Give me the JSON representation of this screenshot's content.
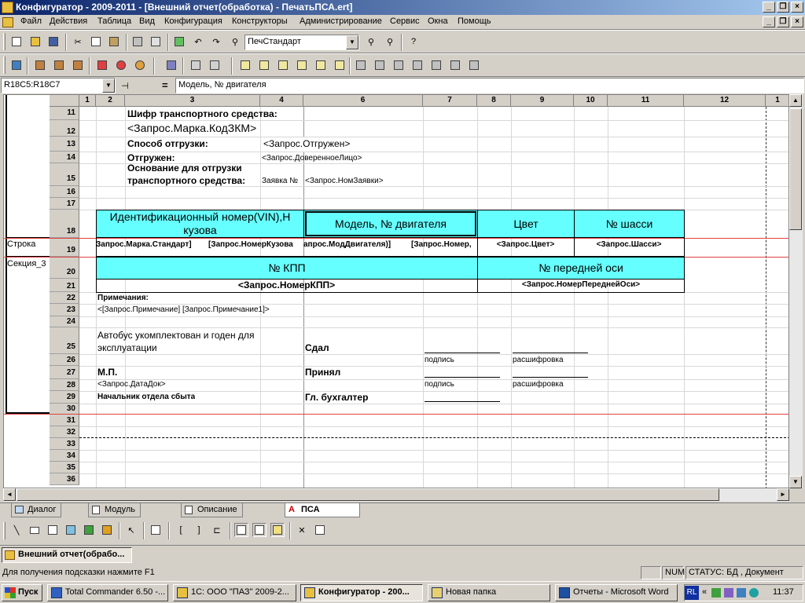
{
  "window": {
    "title": "Конфигуратор - 2009-2011 - [Внешний отчет(обработка) - ПечатьПСА.ert]"
  },
  "menu": [
    "Файл",
    "Действия",
    "Таблица",
    "Вид",
    "Конфигурация",
    "Конструкторы",
    "Администрирование",
    "Сервис",
    "Окна",
    "Помощь"
  ],
  "toolbar": {
    "font_combo": "ПечСтандарт"
  },
  "formula": {
    "cell_ref": "R18C5:R18C7",
    "eq": "=",
    "value": "Модель, № двигателя"
  },
  "columns": [
    "1",
    "2",
    "3",
    "4",
    "6",
    "7",
    "8",
    "9",
    "10",
    "11",
    "12",
    "1"
  ],
  "rows": [
    "11",
    "12",
    "13",
    "14",
    "15",
    "16",
    "17",
    "18",
    "19",
    "20",
    "21",
    "22",
    "23",
    "24",
    "25",
    "26",
    "27",
    "28",
    "29",
    "30",
    "31",
    "32",
    "33",
    "34",
    "35",
    "36"
  ],
  "groups": {
    "stroka": "Строка",
    "section": "Секция_3"
  },
  "cells": {
    "r11": "Шифр транспортного средства:",
    "r12": "<Запрос.Марка.КодЗКМ>",
    "r13a": "Способ отгрузки:",
    "r13b": "<Запрос.Отгружен>",
    "r14a": "Отгружен:",
    "r14b": "<Запрос.ДоверенноеЛицо>",
    "r15top": "Основание для отгрузки",
    "r15a": "транспортного средства:",
    "r15b": "Заявка №",
    "r15c": "<Запрос.НомЗаявки>",
    "h_vin1": "Идентификационный номер(VIN),Н",
    "h_vin2": "кузова",
    "h_model": "Модель, № двигателя",
    "h_color": "Цвет",
    "h_chassis": "№ шасси",
    "r19a": "Запрос.Марка.Стандарт]",
    "r19b": "[Запрос.НомерКузова",
    "r19c": "апрос.МодДвигателя)]",
    "r19d": "[Запрос.Номер,",
    "r19e": "<Запрос.Цвет>",
    "r19f": "<Запрос.Шасси>",
    "h_kpp": "№ КПП",
    "h_axle": "№ передней оси",
    "r21a": "<Запрос.НомерКПП>",
    "r21b": "<Запрос.НомерПереднейОси>",
    "r22": "Примечания:",
    "r23": "<[Запрос.Примечание]   [Запрос.Примечание1]>",
    "r25a1": "Автобус укомплектован и годен для",
    "r25a2": "эксплуатации",
    "r25b": "Сдал",
    "r26a": "подпись",
    "r26b": "расшифровка",
    "r27a": "М.П.",
    "r27b": "Принял",
    "r28a": "<Запрос.ДатаДок>",
    "r28b": "подпись",
    "r28c": "расшифровка",
    "r29a": "Начальник отдела сбыта",
    "r29b": "Гл. бухгалтер"
  },
  "tabs": [
    "Диалог",
    "Модуль",
    "Описание",
    "ПСА"
  ],
  "docbar": {
    "doc": "Внешний отчет(обрабо..."
  },
  "status": {
    "hint": "Для получения подсказки нажмите F1",
    "num": "NUM",
    "state": "СТАТУС: БД , Документ"
  },
  "taskbar": {
    "start": "Пуск",
    "items": [
      "Total Commander 6.50 -...",
      "1С: ООО \"ПАЗ\" 2009-2...",
      "Конфигуратор - 200...",
      "Новая папка",
      "Отчеты - Microsoft Word"
    ],
    "lang": "RL",
    "clock": "11:37"
  }
}
